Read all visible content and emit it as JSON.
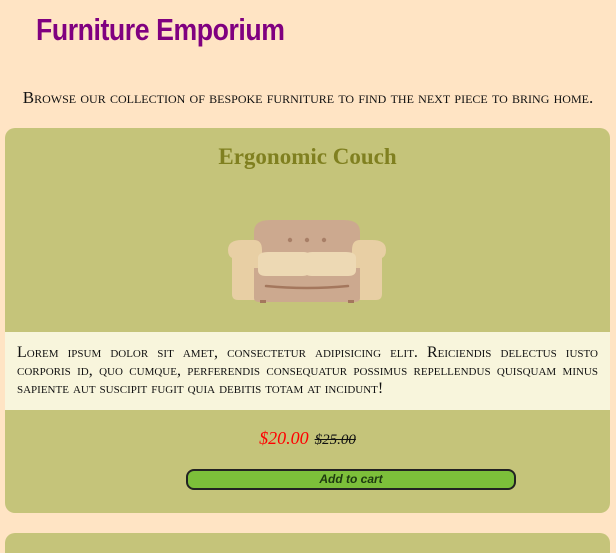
{
  "site": {
    "title": "Furniture Emporium",
    "intro": "Browse our collection of bespoke furniture to find the next piece to bring home."
  },
  "product": {
    "name": "Ergonomic Couch",
    "image_icon": "couch-icon",
    "description": "Lorem ipsum dolor sit amet, consectetur adipisicing elit. Reiciendis delectus iusto corporis id, quo cumque, perferendis consequatur possimus repellendus quisquam minus sapiente aut suscipit fugit quia debitis totam at incidunt!",
    "price": "$20.00",
    "original_price": "$25.00",
    "add_to_cart_label": "Add to cart"
  },
  "colors": {
    "page_background": "#ffe4c4",
    "title": "#800080",
    "card_background": "#c5c47a",
    "card_title": "#808020",
    "description_background": "#f8f5dc",
    "sale_price": "#ff0000",
    "button": "#7cbf3a"
  }
}
